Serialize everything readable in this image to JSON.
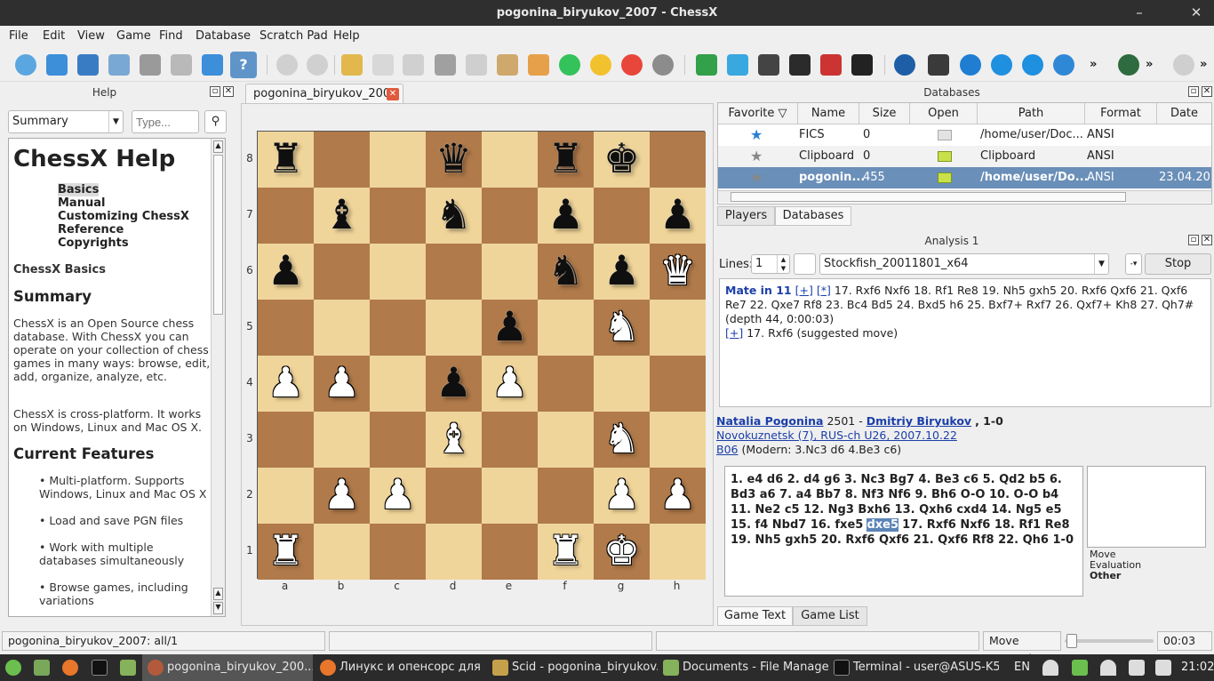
{
  "window": {
    "title": "pogonina_biryukov_2007 - ChessX",
    "minimize": "–",
    "close": "✕"
  },
  "menu": [
    "File",
    "Edit",
    "View",
    "Game",
    "Find",
    "Database",
    "Scratch Pad",
    "Help"
  ],
  "help": {
    "header": "Help",
    "combo_value": "Summary",
    "search_placeholder": "Type...",
    "title": "ChessX Help",
    "links": [
      "Basics",
      "Manual",
      "Customizing ChessX",
      "Reference",
      "Copyrights"
    ],
    "basics_heading": "ChessX Basics",
    "summary_heading": "Summary",
    "para1": "ChessX is an Open Source chess database. With ChessX you can operate on your collection of chess games in many ways: browse, edit, add, organize, analyze, etc.",
    "para2": "ChessX is cross-platform. It works on Windows, Linux and Mac OS X.",
    "features_heading": "Current Features",
    "features": [
      "Multi-platform. Supports Windows, Linux and Mac OS X",
      "Load and save PGN files",
      "Work with multiple databases simultaneously",
      "Browse games, including variations"
    ]
  },
  "board": {
    "tab_label": "pogonina_biryukov_2007",
    "ranks": [
      "8",
      "7",
      "6",
      "5",
      "4",
      "3",
      "2",
      "1"
    ],
    "files": [
      "a",
      "b",
      "c",
      "d",
      "e",
      "f",
      "g",
      "h"
    ],
    "fen": "r2q1rk1/1b1n1p1p/p4npQ/4p1N1/PP1pP3/3B2N1/1PP3PP/R4RK1"
  },
  "databases": {
    "header": "Databases",
    "columns": [
      "Favorite",
      "Name",
      "Size",
      "Open",
      "Path",
      "Format",
      "Date"
    ],
    "rows": [
      {
        "name": "FICS",
        "size": "0",
        "path": "/home/user/Doc...",
        "format": "ANSI",
        "date": ""
      },
      {
        "name": "Clipboard",
        "size": "0",
        "path": "Clipboard",
        "format": "ANSI",
        "date": ""
      },
      {
        "name": "pogonin...",
        "size": "455",
        "path": "/home/user/Do...",
        "format": "ANSI",
        "date": "23.04.20"
      }
    ],
    "tabs": [
      "Players",
      "Databases"
    ]
  },
  "analysis": {
    "header": "Analysis 1",
    "lines_label": "Lines:",
    "lines_value": "1",
    "engine": "Stockfish_20011801_x64",
    "stop_label": "Stop",
    "mate": "Mate in 11",
    "plus": "[+]",
    "star": "[*]",
    "line_text": "17. Rxf6 Nxf6 18. Rf1 Re8 19. Nh5 gxh5 20. Rxf6 Qxf6 21. Qxf6 Re7 22. Qxe7 Rf8 23. Bc4 Bd5 24. Bxd5 h6 25. Bxf7+ Rxf7 26. Qxf7+ Kh8 27. Qh7# (depth 44, 0:00:03)",
    "suggest_plus": "[+]",
    "suggested": "17. Rxf6 (suggested move)"
  },
  "gameinfo": {
    "white": "Natalia Pogonina",
    "white_elo": "2501",
    "sep": " - ",
    "black": "Dmitriy Biryukov",
    "result": ", 1-0",
    "event": "Novokuznetsk (7), RUS-ch U26, 2007.10.22",
    "eco": "B06",
    "opening": "(Modern: 3.Nc3 d6 4.Be3 c6)"
  },
  "gametext": {
    "before": "1. e4 d6 2. d4 g6 3. Nc3 Bg7 4. Be3 c6 5. Qd2 b5 6. Bd3 a6 7. a4 Bb7 8. Nf3 Nf6 9. Bh6 O-O 10. O-O b4 11. Ne2 c5 12. Ng3 Bxh6 13. Qxh6 cxd4 14. Ng5 e5 15. f4 Nbd7 16. fxe5",
    "current": "dxe5",
    "after": "17. Rxf6 Nxf6 18. Rf1 Re8 19. Nh5 gxh5 20. Rxf6 Qxf6 21. Qxf6 Rf8 22. Qh6 1-0",
    "side_labels": [
      "Move",
      "Evaluation",
      "Other"
    ],
    "tabs": [
      "Game Text",
      "Game List"
    ]
  },
  "status": {
    "left": "pogonina_biryukov_2007: all/1",
    "interval_label": "Move Interval:",
    "time": "00:03"
  },
  "taskbar": {
    "tasks": [
      "pogonina_biryukov_200...",
      "Линукс и опенсорс для ...",
      "Scid - pogonina_biryukov...",
      "Documents - File Manager",
      "Terminal - user@ASUS-K5..."
    ],
    "lang": "EN",
    "clock": "21:02"
  }
}
